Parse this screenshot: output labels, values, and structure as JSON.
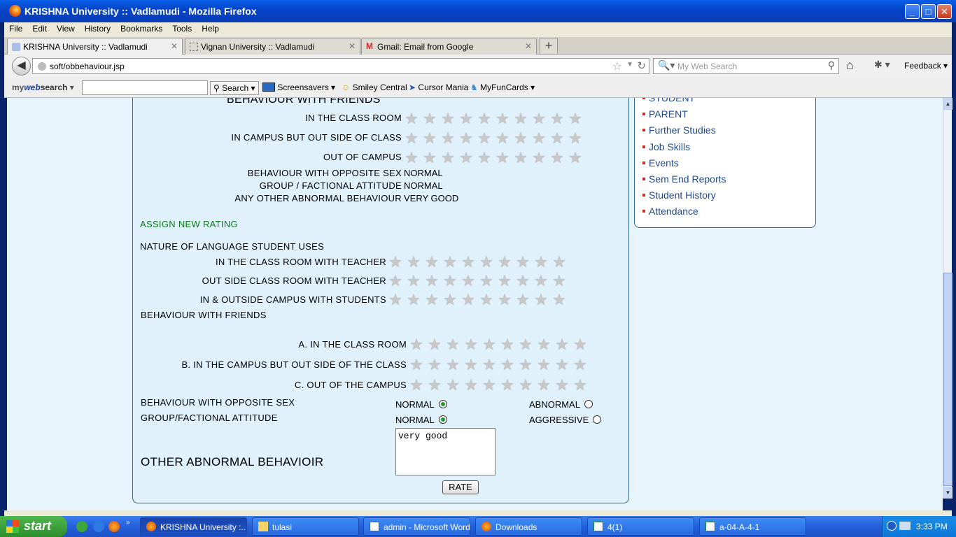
{
  "window": {
    "title": "KRISHNA University :: Vadlamudi - Mozilla Firefox"
  },
  "menu": [
    "File",
    "Edit",
    "View",
    "History",
    "Bookmarks",
    "Tools",
    "Help"
  ],
  "tabs": [
    {
      "label": "KRISHNA University :: Vadlamudi"
    },
    {
      "label": "Vignan University :: Vadlamudi"
    },
    {
      "label": "Gmail: Email from Google"
    }
  ],
  "nav": {
    "url": "soft/obbehaviour.jsp",
    "search_placeholder": "My Web Search",
    "feedback": "Feedback"
  },
  "mws": {
    "logo_a": "my",
    "logo_b": "web",
    "logo_c": "search",
    "search_btn": "Search",
    "items": [
      "Screensavers",
      "Smiley Central",
      "Cursor Mania",
      "MyFunCards"
    ]
  },
  "sidebar": [
    "STUDENT",
    "PARENT",
    "Further Studies",
    "Job Skills",
    "Events",
    "Sem End Reports",
    "Student History",
    "Attendance"
  ],
  "report": {
    "heading": "BEHAVIOUR WITH FRIENDS",
    "rows": [
      "IN THE CLASS ROOM",
      "IN CAMPUS BUT OUT SIDE OF CLASS",
      "OUT OF CAMPUS"
    ],
    "opp_label": "BEHAVIOUR WITH OPPOSITE SEX",
    "opp_value": "NORMAL",
    "group_label": "GROUP / FACTIONAL ATTITUDE",
    "group_value": "NORMAL",
    "other_label": "ANY OTHER ABNORMAL BEHAVIOUR",
    "other_value": "VERY GOOD"
  },
  "form": {
    "assign_heading": "ASSIGN NEW RATING",
    "lang_heading": "NATURE OF LANGUAGE STUDENT USES",
    "lang_rows": [
      "IN THE CLASS ROOM WITH TEACHER",
      "OUT SIDE CLASS ROOM WITH TEACHER",
      "IN & OUTSIDE CAMPUS WITH STUDENTS"
    ],
    "friends_heading": "BEHAVIOUR WITH FRIENDS",
    "friends_rows": [
      "A. IN THE CLASS ROOM",
      "B. IN THE CAMPUS BUT OUT SIDE OF THE CLASS",
      "C. OUT OF THE CAMPUS"
    ],
    "opp_label": "BEHAVIOUR WITH OPPOSITE SEX",
    "opp_opt1": "NORMAL",
    "opp_opt2": "ABNORMAL",
    "group_label": "GROUP/FACTIONAL ATTITUDE",
    "group_opt1": "NORMAL",
    "group_opt2": "AGGRESSIVE",
    "other_label": "OTHER ABNORMAL BEHAVIOIR",
    "other_value": "very good",
    "rate_btn": "RATE"
  },
  "taskbar": {
    "start": "start",
    "buttons": [
      "KRISHNA University :...",
      "tulasi",
      "admin - Microsoft Word",
      "Downloads",
      "4(1)",
      "a-04-A-4-1"
    ],
    "clock": "3:33 PM"
  }
}
